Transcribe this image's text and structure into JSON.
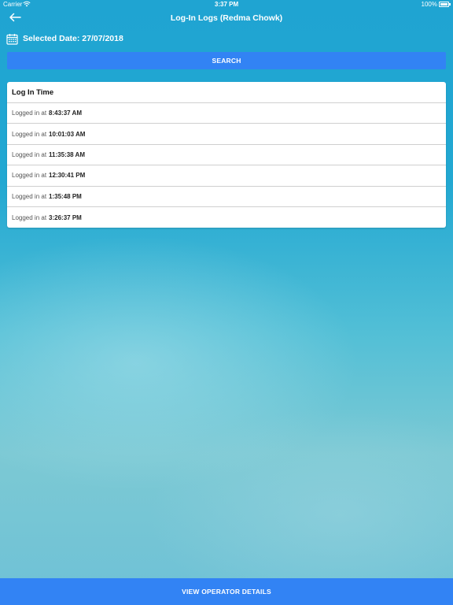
{
  "status_bar": {
    "carrier": "Carrier",
    "wifi_icon": "wifi-icon",
    "time": "3:37 PM",
    "battery_percent": "100%",
    "battery_icon": "battery-icon"
  },
  "nav": {
    "back_icon": "arrow-left-icon",
    "title": "Log-In Logs (Redma Chowk)"
  },
  "date": {
    "icon": "calendar-icon",
    "label": "Selected Date: 27/07/2018"
  },
  "search": {
    "label": "SEARCH"
  },
  "logs": {
    "header": "Log In Time",
    "prefix": "Logged in at",
    "rows": [
      {
        "time": "8:43:37 AM"
      },
      {
        "time": "10:01:03 AM"
      },
      {
        "time": "11:35:38 AM"
      },
      {
        "time": "12:30:41 PM"
      },
      {
        "time": "1:35:48 PM"
      },
      {
        "time": "3:26:37 PM"
      }
    ]
  },
  "footer": {
    "label": "VIEW OPERATOR DETAILS"
  },
  "colors": {
    "accent": "#3283f4",
    "background_top": "#1fa4d2",
    "background_bottom": "#6ec1d6"
  }
}
